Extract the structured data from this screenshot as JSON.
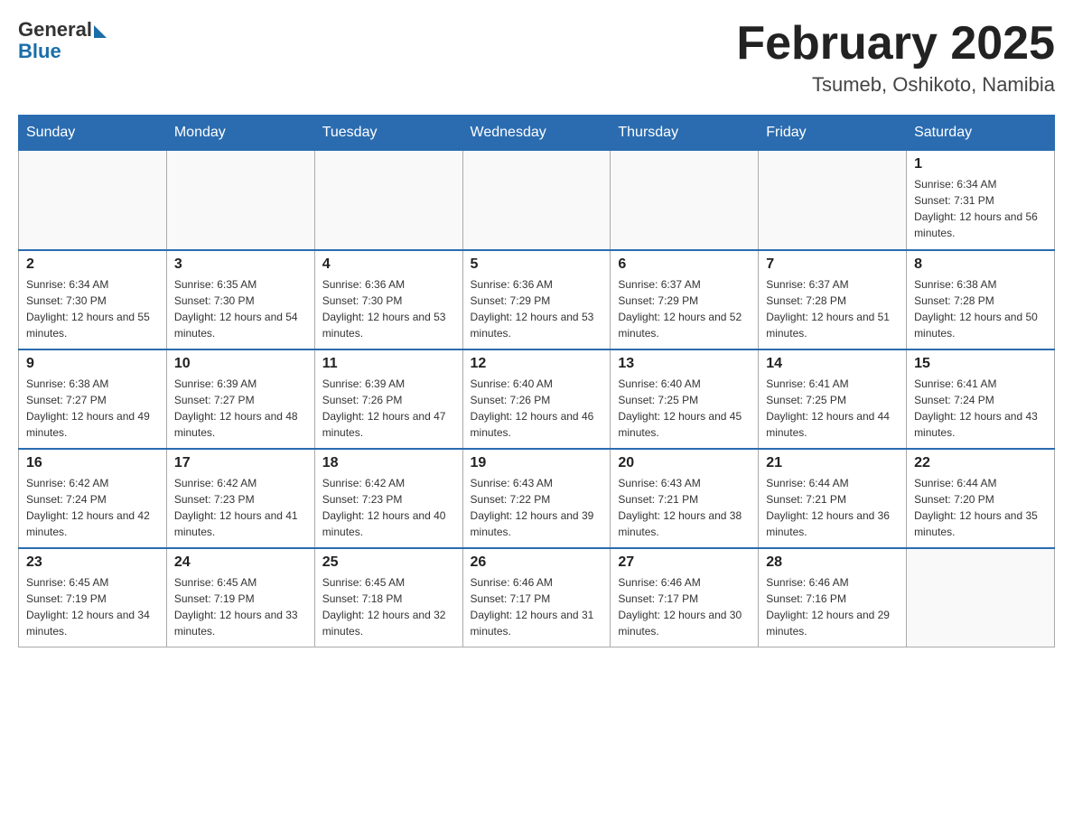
{
  "logo": {
    "general": "General",
    "blue": "Blue"
  },
  "title": "February 2025",
  "location": "Tsumeb, Oshikoto, Namibia",
  "weekdays": [
    "Sunday",
    "Monday",
    "Tuesday",
    "Wednesday",
    "Thursday",
    "Friday",
    "Saturday"
  ],
  "weeks": [
    [
      {
        "day": "",
        "info": ""
      },
      {
        "day": "",
        "info": ""
      },
      {
        "day": "",
        "info": ""
      },
      {
        "day": "",
        "info": ""
      },
      {
        "day": "",
        "info": ""
      },
      {
        "day": "",
        "info": ""
      },
      {
        "day": "1",
        "info": "Sunrise: 6:34 AM\nSunset: 7:31 PM\nDaylight: 12 hours and 56 minutes."
      }
    ],
    [
      {
        "day": "2",
        "info": "Sunrise: 6:34 AM\nSunset: 7:30 PM\nDaylight: 12 hours and 55 minutes."
      },
      {
        "day": "3",
        "info": "Sunrise: 6:35 AM\nSunset: 7:30 PM\nDaylight: 12 hours and 54 minutes."
      },
      {
        "day": "4",
        "info": "Sunrise: 6:36 AM\nSunset: 7:30 PM\nDaylight: 12 hours and 53 minutes."
      },
      {
        "day": "5",
        "info": "Sunrise: 6:36 AM\nSunset: 7:29 PM\nDaylight: 12 hours and 53 minutes."
      },
      {
        "day": "6",
        "info": "Sunrise: 6:37 AM\nSunset: 7:29 PM\nDaylight: 12 hours and 52 minutes."
      },
      {
        "day": "7",
        "info": "Sunrise: 6:37 AM\nSunset: 7:28 PM\nDaylight: 12 hours and 51 minutes."
      },
      {
        "day": "8",
        "info": "Sunrise: 6:38 AM\nSunset: 7:28 PM\nDaylight: 12 hours and 50 minutes."
      }
    ],
    [
      {
        "day": "9",
        "info": "Sunrise: 6:38 AM\nSunset: 7:27 PM\nDaylight: 12 hours and 49 minutes."
      },
      {
        "day": "10",
        "info": "Sunrise: 6:39 AM\nSunset: 7:27 PM\nDaylight: 12 hours and 48 minutes."
      },
      {
        "day": "11",
        "info": "Sunrise: 6:39 AM\nSunset: 7:26 PM\nDaylight: 12 hours and 47 minutes."
      },
      {
        "day": "12",
        "info": "Sunrise: 6:40 AM\nSunset: 7:26 PM\nDaylight: 12 hours and 46 minutes."
      },
      {
        "day": "13",
        "info": "Sunrise: 6:40 AM\nSunset: 7:25 PM\nDaylight: 12 hours and 45 minutes."
      },
      {
        "day": "14",
        "info": "Sunrise: 6:41 AM\nSunset: 7:25 PM\nDaylight: 12 hours and 44 minutes."
      },
      {
        "day": "15",
        "info": "Sunrise: 6:41 AM\nSunset: 7:24 PM\nDaylight: 12 hours and 43 minutes."
      }
    ],
    [
      {
        "day": "16",
        "info": "Sunrise: 6:42 AM\nSunset: 7:24 PM\nDaylight: 12 hours and 42 minutes."
      },
      {
        "day": "17",
        "info": "Sunrise: 6:42 AM\nSunset: 7:23 PM\nDaylight: 12 hours and 41 minutes."
      },
      {
        "day": "18",
        "info": "Sunrise: 6:42 AM\nSunset: 7:23 PM\nDaylight: 12 hours and 40 minutes."
      },
      {
        "day": "19",
        "info": "Sunrise: 6:43 AM\nSunset: 7:22 PM\nDaylight: 12 hours and 39 minutes."
      },
      {
        "day": "20",
        "info": "Sunrise: 6:43 AM\nSunset: 7:21 PM\nDaylight: 12 hours and 38 minutes."
      },
      {
        "day": "21",
        "info": "Sunrise: 6:44 AM\nSunset: 7:21 PM\nDaylight: 12 hours and 36 minutes."
      },
      {
        "day": "22",
        "info": "Sunrise: 6:44 AM\nSunset: 7:20 PM\nDaylight: 12 hours and 35 minutes."
      }
    ],
    [
      {
        "day": "23",
        "info": "Sunrise: 6:45 AM\nSunset: 7:19 PM\nDaylight: 12 hours and 34 minutes."
      },
      {
        "day": "24",
        "info": "Sunrise: 6:45 AM\nSunset: 7:19 PM\nDaylight: 12 hours and 33 minutes."
      },
      {
        "day": "25",
        "info": "Sunrise: 6:45 AM\nSunset: 7:18 PM\nDaylight: 12 hours and 32 minutes."
      },
      {
        "day": "26",
        "info": "Sunrise: 6:46 AM\nSunset: 7:17 PM\nDaylight: 12 hours and 31 minutes."
      },
      {
        "day": "27",
        "info": "Sunrise: 6:46 AM\nSunset: 7:17 PM\nDaylight: 12 hours and 30 minutes."
      },
      {
        "day": "28",
        "info": "Sunrise: 6:46 AM\nSunset: 7:16 PM\nDaylight: 12 hours and 29 minutes."
      },
      {
        "day": "",
        "info": ""
      }
    ]
  ]
}
